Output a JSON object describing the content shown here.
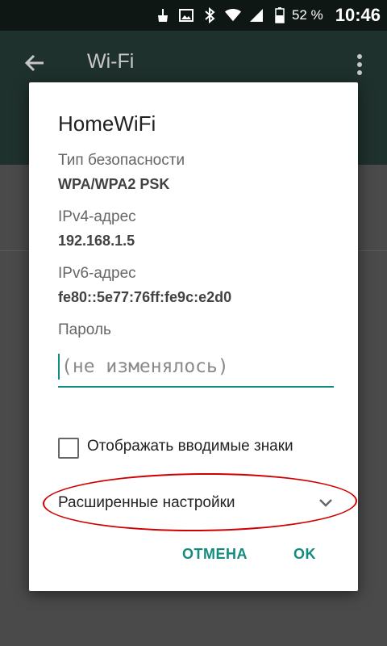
{
  "status_bar": {
    "icons": [
      "broom-icon",
      "image-icon",
      "bluetooth-icon",
      "wifi-icon",
      "signal-icon",
      "battery-icon"
    ],
    "battery_percent": "52 %",
    "time": "10:46"
  },
  "app_bar": {
    "title": "Wi-Fi"
  },
  "dialog": {
    "title": "HomeWiFi",
    "security_label": "Тип безопасности",
    "security_value": "WPA/WPA2 PSK",
    "ipv4_label": "IPv4-адрес",
    "ipv4_value": "192.168.1.5",
    "ipv6_label": "IPv6-адрес",
    "ipv6_value": "fe80::5e77:76ff:fe9c:e2d0",
    "password_label": "Пароль",
    "password_placeholder": "(не изменялось)",
    "show_password_label": "Отображать вводимые знаки",
    "advanced_label": "Расширенные настройки",
    "cancel_label": "ОТМЕНА",
    "ok_label": "OK"
  },
  "colors": {
    "accent": "#128c7e",
    "annotation": "#d00000"
  }
}
